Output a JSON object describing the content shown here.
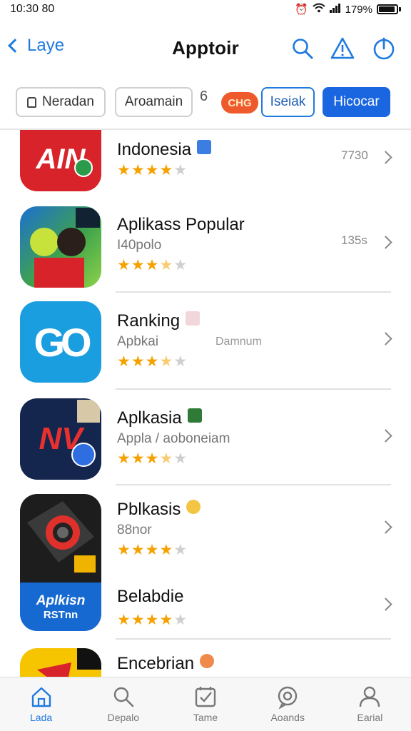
{
  "status_bar": {
    "time": "10:30 80",
    "battery": "179%"
  },
  "nav": {
    "back_label": "Laye",
    "title": "Apptoir"
  },
  "chips": [
    {
      "label": "Neradan"
    },
    {
      "label": "Aroamain"
    },
    {
      "label": "6"
    },
    {
      "label": "CHG"
    },
    {
      "label": "Iseiak"
    },
    {
      "label": "Hicocar"
    }
  ],
  "apps": [
    {
      "name": "Indonesia",
      "subtitle": "",
      "rating": 4,
      "size": "7730",
      "icon_text": "AIN",
      "accent": "#d9232a"
    },
    {
      "name": "Aplikass Popular",
      "subtitle": "I40polo",
      "rating": 3.5,
      "size": "135s",
      "icon_text": "",
      "accent": "#2ea043"
    },
    {
      "name": "Ranking",
      "subtitle": "Apbkai",
      "subtitle2": "Damnum",
      "rating": 3.5,
      "size": "",
      "icon_text": "GO",
      "accent": "#1a9ee0"
    },
    {
      "name": "Aplkasia",
      "subtitle": "Appla / aoboneiam",
      "rating": 3.5,
      "size": "",
      "icon_text": "NV",
      "accent": "#14254e"
    },
    {
      "name": "Pblkasis",
      "subtitle": "88nor",
      "rating": 4.5,
      "size": "",
      "icon_text": "",
      "accent": "#111111"
    },
    {
      "name": "Belabdie",
      "subtitle": "",
      "rating": 4.5,
      "size": "",
      "icon_text": "Aplkisn",
      "icon_text2": "RSTnn",
      "accent": "#1669d0"
    },
    {
      "name": "Encebrian",
      "subtitle": "",
      "rating": 0,
      "size": "",
      "icon_text": "",
      "accent": "#f7c400"
    }
  ],
  "tabs": [
    {
      "label": "Lada",
      "icon": "home-icon",
      "active": true
    },
    {
      "label": "Depalo",
      "icon": "search-icon",
      "active": false
    },
    {
      "label": "Tame",
      "icon": "checklist-icon",
      "active": false
    },
    {
      "label": "Aoands",
      "icon": "chat-icon",
      "active": false
    },
    {
      "label": "Earial",
      "icon": "profile-icon",
      "active": false
    }
  ],
  "colors": {
    "accent": "#1f7ae0",
    "star": "#f5a200",
    "primary_button": "#1a66e0"
  }
}
